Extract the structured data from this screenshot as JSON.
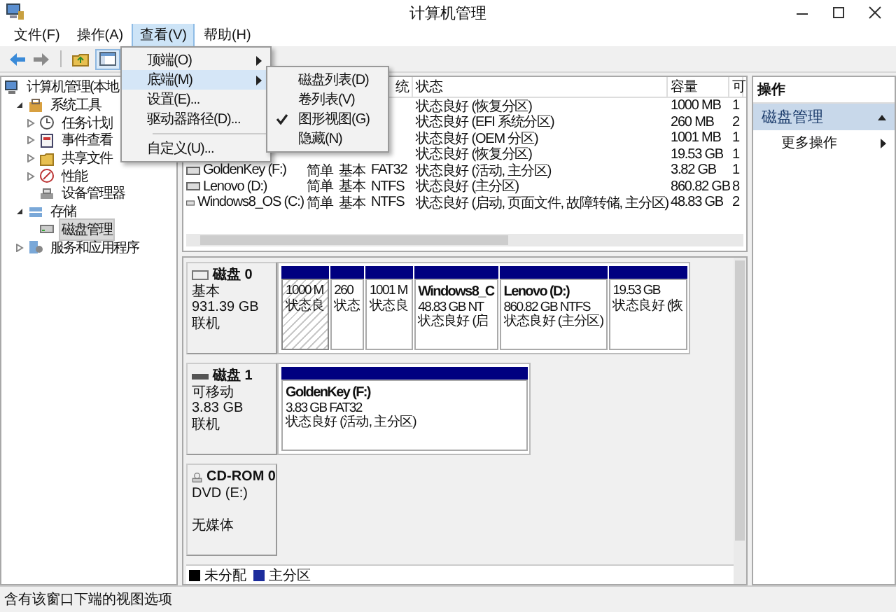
{
  "window": {
    "title": "计算机管理"
  },
  "menu_bar": [
    {
      "label": "文件(F)",
      "selected": false
    },
    {
      "label": "操作(A)",
      "selected": false
    },
    {
      "label": "查看(V)",
      "selected": true
    },
    {
      "label": "帮助(H)",
      "selected": false
    }
  ],
  "view_menu": [
    {
      "label": "顶端(O)",
      "submenu": true,
      "selected": false
    },
    {
      "label": "底端(M)",
      "submenu": true,
      "selected": true
    },
    {
      "label": "设置(E)...",
      "submenu": false,
      "selected": false
    },
    {
      "label": "驱动器路径(D)...",
      "submenu": false,
      "selected": false
    },
    {
      "label": "自定义(U)...",
      "submenu": false,
      "selected": false,
      "separator_before": true
    }
  ],
  "submenu": [
    {
      "label": "磁盘列表(D)",
      "checked": false
    },
    {
      "label": "卷列表(V)",
      "checked": false
    },
    {
      "label": "图形视图(G)",
      "checked": true
    },
    {
      "label": "隐藏(N)",
      "checked": false
    }
  ],
  "tree": [
    {
      "label": "计算机管理(本地",
      "selected": false,
      "children": [
        {
          "label": "系统工具",
          "selected": false,
          "expanded": true,
          "children": [
            {
              "label": "任务计划",
              "selected": false,
              "expanded": false
            },
            {
              "label": "事件查看",
              "selected": false,
              "expanded": false
            },
            {
              "label": "共享文件",
              "selected": false,
              "expanded": false
            },
            {
              "label": "性能",
              "selected": false,
              "expanded": false
            },
            {
              "label": "设备管理器",
              "selected": false
            }
          ]
        },
        {
          "label": "存储",
          "selected": false,
          "expanded": true,
          "children": [
            {
              "label": "磁盘管理",
              "selected": true
            }
          ]
        },
        {
          "label": "服务和应用程序",
          "selected": false,
          "expanded": false
        }
      ]
    }
  ],
  "table": {
    "columns": [
      "统",
      "状态",
      "容量",
      "可"
    ],
    "rows": [
      {
        "status": "状态良好 (恢复分区)",
        "capacity": "1000 MB",
        "column_7": "1"
      },
      {
        "status": "状态良好 (EFI 系统分区)",
        "capacity": "260 MB",
        "column_7": "2"
      },
      {
        "status": "状态良好 (OEM 分区)",
        "capacity": "1001 MB",
        "column_7": "1"
      },
      {
        "status": "状态良好 (恢复分区)",
        "capacity": "19.53 GB",
        "column_7": "1"
      },
      {
        "volume": "GoldenKey (F:)",
        "layout": "简单",
        "type": "基本",
        "file_system": "FAT32",
        "status": "状态良好 (活动, 主分区)",
        "capacity": "3.82 GB",
        "column_7": "1"
      },
      {
        "volume": "Lenovo (D:)",
        "layout": "简单",
        "type": "基本",
        "file_system": "NTFS",
        "status": "状态良好 (主分区)",
        "capacity": "860.82 GB",
        "column_7": "8"
      },
      {
        "volume": "Windows8_OS (C:)",
        "layout": "简单",
        "type": "基本",
        "file_system": "NTFS",
        "status": "状态良好 (启动, 页面文件, 故障转储, 主分区)",
        "capacity": "48.83 GB",
        "column_7": "2"
      }
    ]
  },
  "disks": [
    {
      "kind": "disk",
      "name": "磁盘 0",
      "lines": [
        "基本",
        "931.39 GB",
        "联机"
      ],
      "partitions": [
        {
          "lines": [
            "1000 M",
            "状态良"
          ],
          "selected": true
        },
        {
          "lines": [
            "260",
            "状态"
          ],
          "selected": false
        },
        {
          "lines": [
            "1001 M",
            "状态良"
          ],
          "selected": false
        },
        {
          "title": "Windows8_C",
          "lines": [
            "48.83 GB NT",
            "状态良好 (启"
          ],
          "selected": false
        },
        {
          "title": "Lenovo  (D:)",
          "lines": [
            "860.82 GB NTFS",
            "状态良好 (主分区)"
          ],
          "selected": false
        },
        {
          "lines": [
            "19.53 GB",
            "状态良好 (恢"
          ],
          "selected": false
        }
      ]
    },
    {
      "kind": "removable",
      "name": "磁盘 1",
      "lines": [
        "可移动",
        "3.83 GB",
        "联机"
      ],
      "partitions": [
        {
          "title": "GoldenKey  (F:)",
          "lines": [
            "3.83 GB FAT32",
            "状态良好 (活动, 主分区)"
          ],
          "selected": false
        }
      ]
    },
    {
      "kind": "cdrom",
      "name": "CD-ROM 0",
      "lines": [
        "DVD (E:)",
        "无媒体"
      ]
    }
  ],
  "legend": [
    {
      "label": "未分配",
      "color": "#000000"
    },
    {
      "label": "主分区",
      "color": "#1c2c9c"
    }
  ],
  "actions": {
    "title": "操作",
    "section": "磁盘管理",
    "items": [
      "更多操作"
    ]
  },
  "status_bar": "含有该窗口下端的视图选项"
}
